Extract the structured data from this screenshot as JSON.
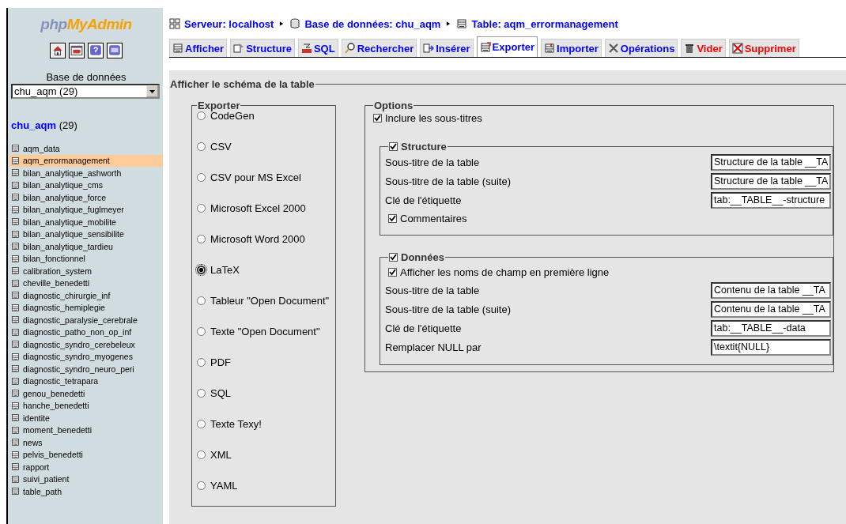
{
  "sidebar": {
    "logo": {
      "part_1": "php",
      "part_2": "MyAdmin"
    },
    "database_label": "Base de données",
    "database_select": {
      "value": "chu_aqm (29)"
    },
    "database_link": {
      "name": "chu_aqm",
      "count": "(29)"
    },
    "tables": [
      {
        "name": "aqm_data",
        "selected": false
      },
      {
        "name": "aqm_errormanagement",
        "selected": true
      },
      {
        "name": "bilan_analytique_ashworth",
        "selected": false
      },
      {
        "name": "bilan_analytique_cms",
        "selected": false
      },
      {
        "name": "bilan_analytique_force",
        "selected": false
      },
      {
        "name": "bilan_analytique_fuglmeyer",
        "selected": false
      },
      {
        "name": "bilan_analytique_mobilite",
        "selected": false
      },
      {
        "name": "bilan_analytique_sensibilite",
        "selected": false
      },
      {
        "name": "bilan_analytique_tardieu",
        "selected": false
      },
      {
        "name": "bilan_fonctionnel",
        "selected": false
      },
      {
        "name": "calibration_system",
        "selected": false
      },
      {
        "name": "cheville_benedetti",
        "selected": false
      },
      {
        "name": "diagnostic_chirurgie_inf",
        "selected": false
      },
      {
        "name": "diagnostic_hemiplegie",
        "selected": false
      },
      {
        "name": "diagnostic_paralysie_cerebrale",
        "selected": false
      },
      {
        "name": "diagnostic_patho_non_op_inf",
        "selected": false
      },
      {
        "name": "diagnostic_syndro_cerebeleux",
        "selected": false
      },
      {
        "name": "diagnostic_syndro_myogenes",
        "selected": false
      },
      {
        "name": "diagnostic_syndro_neuro_peri",
        "selected": false
      },
      {
        "name": "diagnostic_tetrapara",
        "selected": false
      },
      {
        "name": "genou_benedetti",
        "selected": false
      },
      {
        "name": "hanche_benedetti",
        "selected": false
      },
      {
        "name": "identite",
        "selected": false
      },
      {
        "name": "moment_benedetti",
        "selected": false
      },
      {
        "name": "news",
        "selected": false
      },
      {
        "name": "pelvis_benedetti",
        "selected": false
      },
      {
        "name": "rapport",
        "selected": false
      },
      {
        "name": "suivi_patient",
        "selected": false
      },
      {
        "name": "table_path",
        "selected": false
      }
    ]
  },
  "breadcrumb": [
    "Serveur: localhost",
    "Base de données: chu_aqm",
    "Table: aqm_errormanagement"
  ],
  "tabs": [
    {
      "label": "Afficher",
      "selected": false,
      "kind": "normal"
    },
    {
      "label": "Structure",
      "selected": false,
      "kind": "normal"
    },
    {
      "label": "SQL",
      "selected": false,
      "kind": "normal"
    },
    {
      "label": "Rechercher",
      "selected": false,
      "kind": "normal"
    },
    {
      "label": "Insérer",
      "selected": false,
      "kind": "normal"
    },
    {
      "label": "Exporter",
      "selected": true,
      "kind": "normal"
    },
    {
      "label": "Importer",
      "selected": false,
      "kind": "normal"
    },
    {
      "label": "Opérations",
      "selected": false,
      "kind": "normal"
    },
    {
      "label": "Vider",
      "selected": false,
      "kind": "danger"
    },
    {
      "label": "Supprimer",
      "selected": false,
      "kind": "danger"
    }
  ],
  "panel": {
    "title": "Afficher le schéma de la table",
    "exporter": {
      "title": "Exporter",
      "formats": [
        {
          "label": "CodeGen",
          "selected": false
        },
        {
          "label": "CSV",
          "selected": false
        },
        {
          "label": "CSV pour MS Excel",
          "selected": false
        },
        {
          "label": "Microsoft Excel 2000",
          "selected": false
        },
        {
          "label": "Microsoft Word 2000",
          "selected": false
        },
        {
          "label": "LaTeX",
          "selected": true
        },
        {
          "label": "Tableur \"Open Document\"",
          "selected": false
        },
        {
          "label": "Texte \"Open Document\"",
          "selected": false
        },
        {
          "label": "PDF",
          "selected": false
        },
        {
          "label": "SQL",
          "selected": false
        },
        {
          "label": "Texte Texy!",
          "selected": false
        },
        {
          "label": "XML",
          "selected": false
        },
        {
          "label": "YAML",
          "selected": false
        }
      ]
    },
    "options": {
      "title": "Options",
      "include_captions": {
        "label": "Inclure les sous-titres",
        "checked": true
      },
      "groups": [
        {
          "title": "Structure",
          "checked": true,
          "rows": [
            {
              "kind": "field",
              "label": "Sous-titre de la table",
              "value": "Structure de la table __TA"
            },
            {
              "kind": "field",
              "label": "Sous-titre de la table (suite)",
              "value": "Structure de la table __TA"
            },
            {
              "kind": "field",
              "label": "Clé de l'étiquette",
              "value": "tab:__TABLE__-structure"
            },
            {
              "kind": "checkbox",
              "label": "Commentaires",
              "checked": true
            }
          ]
        },
        {
          "title": "Données",
          "checked": true,
          "rows": [
            {
              "kind": "checkbox",
              "label": "Afficher les noms de champ en première ligne",
              "checked": true
            },
            {
              "kind": "field",
              "label": "Sous-titre de la table",
              "value": "Contenu de la table __TA"
            },
            {
              "kind": "field",
              "label": "Sous-titre de la table (suite)",
              "value": "Contenu de la table __TA"
            },
            {
              "kind": "field",
              "label": "Clé de l'étiquette",
              "value": "tab:__TABLE__-data"
            },
            {
              "kind": "field",
              "label": "Remplacer NULL par",
              "value": "\\textit{NULL}"
            }
          ]
        }
      ]
    }
  }
}
